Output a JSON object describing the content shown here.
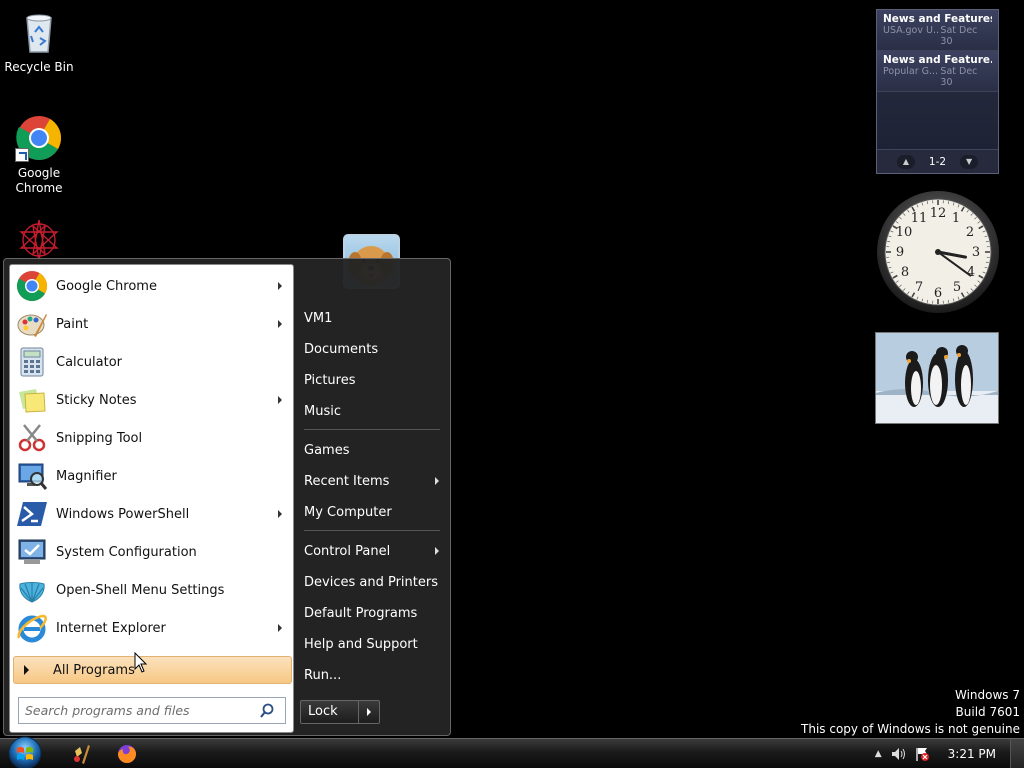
{
  "desktop_icons": [
    {
      "name": "recycle-bin",
      "label": "Recycle Bin"
    },
    {
      "name": "google-chrome",
      "label": "Google Chrome"
    }
  ],
  "news_gadget": {
    "items": [
      {
        "title": "News and Features f...",
        "source": "USA.gov U...",
        "date": "Sat Dec 30"
      },
      {
        "title": "News and Feature...",
        "source": "Popular G...",
        "date": "Sat Dec 30"
      }
    ],
    "pager": "1-2"
  },
  "clock_gadget": {
    "hour": 3,
    "minute": 21
  },
  "start_menu": {
    "programs": [
      {
        "label": "Google Chrome",
        "icon": "chrome-icon",
        "submenu": true
      },
      {
        "label": "Paint",
        "icon": "paint-icon",
        "submenu": true
      },
      {
        "label": "Calculator",
        "icon": "calculator-icon",
        "submenu": false
      },
      {
        "label": "Sticky Notes",
        "icon": "sticky-notes-icon",
        "submenu": true
      },
      {
        "label": "Snipping Tool",
        "icon": "snipping-tool-icon",
        "submenu": false
      },
      {
        "label": "Magnifier",
        "icon": "magnifier-icon",
        "submenu": false
      },
      {
        "label": "Windows PowerShell",
        "icon": "powershell-icon",
        "submenu": true
      },
      {
        "label": "System Configuration",
        "icon": "system-configuration-icon",
        "submenu": false
      },
      {
        "label": "Open-Shell Menu Settings",
        "icon": "open-shell-icon",
        "submenu": false
      },
      {
        "label": "Internet Explorer",
        "icon": "internet-explorer-icon",
        "submenu": true
      }
    ],
    "all_programs": "All Programs",
    "search_placeholder": "Search programs and files",
    "right_items": [
      {
        "label": "VM1",
        "submenu": false
      },
      {
        "label": "Documents",
        "submenu": false
      },
      {
        "label": "Pictures",
        "submenu": false
      },
      {
        "label": "Music",
        "submenu": false
      },
      {
        "label": "Games",
        "submenu": false
      },
      {
        "label": "Recent Items",
        "submenu": true
      },
      {
        "label": "My Computer",
        "submenu": false
      },
      {
        "label": "Control Panel",
        "submenu": true
      },
      {
        "label": "Devices and Printers",
        "submenu": false
      },
      {
        "label": "Default Programs",
        "submenu": false
      },
      {
        "label": "Help and Support",
        "submenu": false
      },
      {
        "label": "Run...",
        "submenu": false
      }
    ],
    "lock_label": "Lock"
  },
  "watermark": {
    "line1": "Windows 7",
    "line2": "Build 7601",
    "line3": "This copy of Windows is not genuine"
  },
  "taskbar": {
    "pinned": [
      "paint-icon",
      "firefox-icon"
    ],
    "time": "3:21 PM"
  }
}
